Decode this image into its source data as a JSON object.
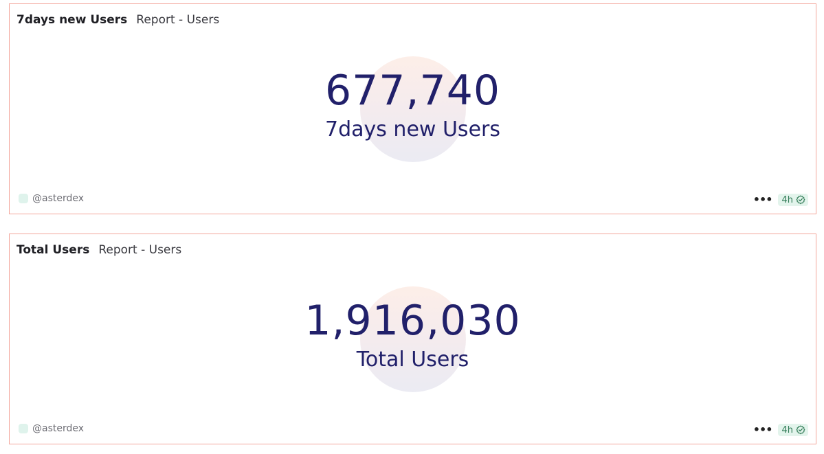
{
  "panels": [
    {
      "title": "7days new Users",
      "subtitle": "Report - Users",
      "value": "677,740",
      "label": "7days new Users",
      "owner": "@asterdex",
      "more_label": "•••",
      "freshness": "4h"
    },
    {
      "title": "Total Users",
      "subtitle": "Report - Users",
      "value": "1,916,030",
      "label": "Total Users",
      "owner": "@asterdex",
      "more_label": "•••",
      "freshness": "4h"
    }
  ],
  "colors": {
    "border": "#f3a59a",
    "kpi_text": "#21206a",
    "badge_bg": "#e3f4ec",
    "badge_text": "#2f7a55"
  },
  "icons": {
    "more": "more-horizontal-icon",
    "status": "check-circle-icon"
  }
}
